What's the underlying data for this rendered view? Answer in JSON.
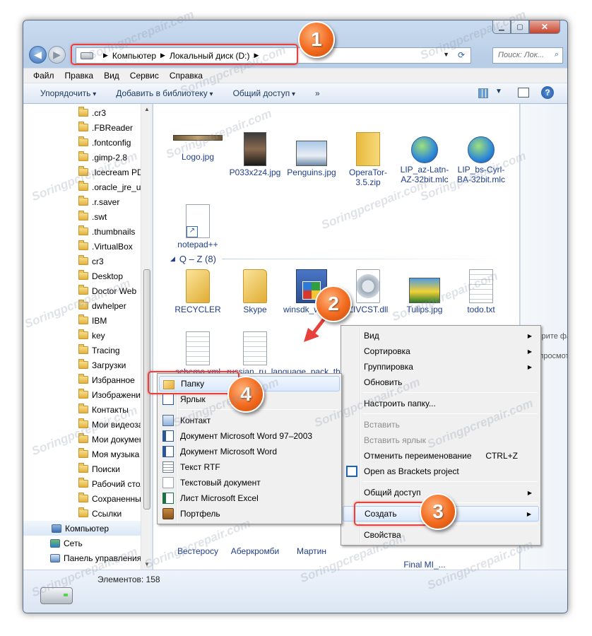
{
  "window": {
    "address": [
      "Компьютер",
      "Локальный диск (D:)"
    ],
    "search_placeholder": "Поиск: Лок...",
    "menu": [
      "Файл",
      "Правка",
      "Вид",
      "Сервис",
      "Справка"
    ],
    "toolbar": [
      "Упорядочить",
      "Добавить в библиотеку",
      "Общий доступ",
      "»"
    ]
  },
  "nav": [
    {
      "label": ".cr3",
      "icon": "folder-icon"
    },
    {
      "label": ".FBReader",
      "icon": "folder-icon"
    },
    {
      "label": ".fontconfig",
      "icon": "folder-icon"
    },
    {
      "label": ".gimp-2.8",
      "icon": "folder-icon"
    },
    {
      "label": ".Icecream PDF Con",
      "icon": "folder-icon"
    },
    {
      "label": ".oracle_jre_usage",
      "icon": "folder-icon"
    },
    {
      "label": ".r.saver",
      "icon": "folder-icon"
    },
    {
      "label": ".swt",
      "icon": "folder-icon"
    },
    {
      "label": ".thumbnails",
      "icon": "folder-icon"
    },
    {
      "label": ".VirtualBox",
      "icon": "folder-icon"
    },
    {
      "label": "cr3",
      "icon": "folder-icon"
    },
    {
      "label": "Desktop",
      "icon": "folder-icon"
    },
    {
      "label": "Doctor Web",
      "icon": "folder-icon"
    },
    {
      "label": "dwhelper",
      "icon": "folder-icon"
    },
    {
      "label": "IBM",
      "icon": "folder-icon"
    },
    {
      "label": "key",
      "icon": "folder-icon"
    },
    {
      "label": "Tracing",
      "icon": "folder-icon"
    },
    {
      "label": "Загрузки",
      "icon": "folder-icon"
    },
    {
      "label": "Избранное",
      "icon": "folder-icon"
    },
    {
      "label": "Изображения",
      "icon": "folder-icon"
    },
    {
      "label": "Контакты",
      "icon": "folder-icon"
    },
    {
      "label": "Мои видеозаписи",
      "icon": "folder-icon"
    },
    {
      "label": "Мои документы",
      "icon": "folder-icon"
    },
    {
      "label": "Моя музыка",
      "icon": "folder-icon"
    },
    {
      "label": "Поиски",
      "icon": "folder-icon"
    },
    {
      "label": "Рабочий стол",
      "icon": "folder-icon"
    },
    {
      "label": "Сохраненные игры",
      "icon": "folder-icon"
    },
    {
      "label": "Ссылки",
      "icon": "folder-icon"
    },
    {
      "label": "Компьютер",
      "icon": "computer-icon"
    },
    {
      "label": "Сеть",
      "icon": "network-icon"
    },
    {
      "label": "Панель управления",
      "icon": "control-panel-icon"
    }
  ],
  "files_top": [
    {
      "name": "Logo.jpg",
      "icon": "image-strip-icon"
    },
    {
      "name": "P033x2z4.jpg",
      "icon": "photo-icon"
    },
    {
      "name": "Penguins.jpg",
      "icon": "photo-icon"
    },
    {
      "name": "OperaTor-3.5.zip",
      "icon": "zip-icon"
    },
    {
      "name": "LIP_az-Latn-AZ-32bit.mlc",
      "icon": "globe-icon"
    },
    {
      "name": "LIP_bs-Cyrl-BA-32bit.mlc",
      "icon": "globe-icon"
    },
    {
      "name": "notepad++",
      "icon": "shortcut-icon"
    }
  ],
  "group_header": "Q – Z (8)",
  "files_qz": [
    {
      "name": "RECYCLER",
      "icon": "folder-icon"
    },
    {
      "name": "Skype",
      "icon": "folder-icon"
    },
    {
      "name": "winsdk_web.exe",
      "icon": "installer-icon"
    },
    {
      "name": "ZIVCST.dll",
      "icon": "dll-icon"
    },
    {
      "name": "Tulips.jpg",
      "icon": "photo-icon"
    },
    {
      "name": "todo.txt",
      "icon": "text-icon"
    },
    {
      "name": "schema.xml",
      "icon": "text-icon"
    },
    {
      "name": "russian_ru_language_pack_thunde",
      "icon": "text-icon"
    }
  ],
  "bottom_labels": [
    "Вестеросу",
    "Аберкромби",
    "Мартин",
    "Final MI_..."
  ],
  "detail_pane": "Выберите файл для предпросмотра.",
  "status": "Элементов: 158",
  "context_menu": {
    "items": [
      {
        "label": "Вид",
        "submenu": true
      },
      {
        "label": "Сортировка",
        "submenu": true
      },
      {
        "label": "Группировка",
        "submenu": true
      },
      {
        "label": "Обновить"
      },
      {
        "sep": true
      },
      {
        "label": "Настроить папку..."
      },
      {
        "sep": true
      },
      {
        "label": "Вставить",
        "disabled": true
      },
      {
        "label": "Вставить ярлык",
        "disabled": true
      },
      {
        "label": "Отменить переименование",
        "shortcut": "CTRL+Z"
      },
      {
        "label": "Open as Brackets project",
        "icon": "brackets-icon"
      },
      {
        "sep": true
      },
      {
        "label": "Общий доступ",
        "submenu": true
      },
      {
        "sep": true
      },
      {
        "label": "Создать",
        "submenu": true,
        "highlight": true
      },
      {
        "sep": true
      },
      {
        "label": "Свойства"
      }
    ]
  },
  "submenu": {
    "items": [
      {
        "label": "Папку",
        "icon": "folder-icon",
        "highlight": true
      },
      {
        "label": "Ярлык",
        "icon": "shortcut-icon"
      },
      {
        "sep": true
      },
      {
        "label": "Контакт",
        "icon": "contact-icon"
      },
      {
        "label": "Документ Microsoft Word 97–2003",
        "icon": "word-icon"
      },
      {
        "label": "Документ Microsoft Word",
        "icon": "word-icon"
      },
      {
        "label": "Текст RTF",
        "icon": "rtf-icon"
      },
      {
        "label": "Текстовый документ",
        "icon": "text-icon"
      },
      {
        "label": "Лист Microsoft Excel",
        "icon": "excel-icon"
      },
      {
        "label": "Портфель",
        "icon": "briefcase-icon"
      }
    ]
  },
  "badges": [
    "1",
    "2",
    "3",
    "4"
  ],
  "watermark": "Soringpcrepair.com"
}
